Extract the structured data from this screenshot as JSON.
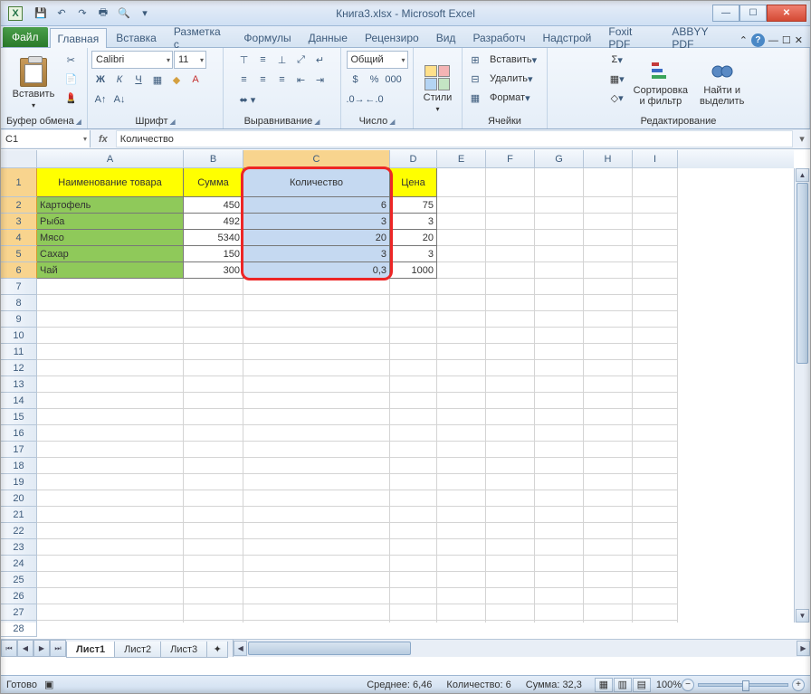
{
  "titlebar": {
    "title": "Книга3.xlsx - Microsoft Excel",
    "excel_glyph": "X"
  },
  "qat": {
    "save": "💾",
    "undo": "↶",
    "redo": "↷",
    "more1": "🖶",
    "more2": "🔍"
  },
  "win": {
    "min": "—",
    "max": "☐",
    "close": "✕"
  },
  "tabs": {
    "file": "Файл",
    "home": "Главная",
    "insert": "Вставка",
    "layout": "Разметка с",
    "formulas": "Формулы",
    "data": "Данные",
    "review": "Рецензиро",
    "view": "Вид",
    "developer": "Разработч",
    "addins": "Надстрой",
    "foxit": "Foxit PDF",
    "abbyy": "ABBYY PDF"
  },
  "ribbon": {
    "clipboard": {
      "label": "Буфер обмена",
      "paste": "Вставить",
      "cut": "✂",
      "copy": "📄",
      "format_painter": "💄"
    },
    "font": {
      "label": "Шрифт",
      "name": "Calibri",
      "size": "11",
      "bold": "Ж",
      "italic": "К",
      "underline": "Ч"
    },
    "align": {
      "label": "Выравнивание"
    },
    "number": {
      "label": "Число",
      "format": "Общий"
    },
    "styles": {
      "label": "",
      "button": "Стили"
    },
    "cells": {
      "label": "Ячейки",
      "insert": "Вставить",
      "delete": "Удалить",
      "format": "Формат"
    },
    "editing": {
      "label": "Редактирование",
      "sigma": "Σ",
      "fill": "▦",
      "clear": "◇",
      "sort": "Сортировка\nи фильтр",
      "find": "Найти и\nвыделить"
    }
  },
  "namebox": "C1",
  "formula": "Количество",
  "columns": [
    "A",
    "B",
    "C",
    "D",
    "E",
    "F",
    "G",
    "H",
    "I"
  ],
  "row_nums": [
    1,
    2,
    3,
    4,
    5,
    6,
    7,
    8,
    9,
    10,
    11,
    12,
    13,
    14,
    15,
    16,
    17,
    18,
    19,
    20,
    21,
    22,
    23,
    24,
    25,
    26,
    27,
    28
  ],
  "headers": {
    "A": "Наименование товара",
    "B": "Сумма",
    "C": "Количество",
    "D": "Цена"
  },
  "data_rows": [
    {
      "A": "Картофель",
      "B": "450",
      "C": "6",
      "D": "75"
    },
    {
      "A": "Рыба",
      "B": "492",
      "C": "3",
      "D": "3"
    },
    {
      "A": "Мясо",
      "B": "5340",
      "C": "20",
      "D": "20"
    },
    {
      "A": "Сахар",
      "B": "150",
      "C": "3",
      "D": "3"
    },
    {
      "A": "Чай",
      "B": "300",
      "C": "0,3",
      "D": "1000"
    }
  ],
  "sheets": {
    "s1": "Лист1",
    "s2": "Лист2",
    "s3": "Лист3"
  },
  "status": {
    "ready": "Готово",
    "avg_label": "Среднее:",
    "avg": "6,46",
    "count_label": "Количество:",
    "count": "6",
    "sum_label": "Сумма:",
    "sum": "32,3",
    "zoom": "100%"
  }
}
